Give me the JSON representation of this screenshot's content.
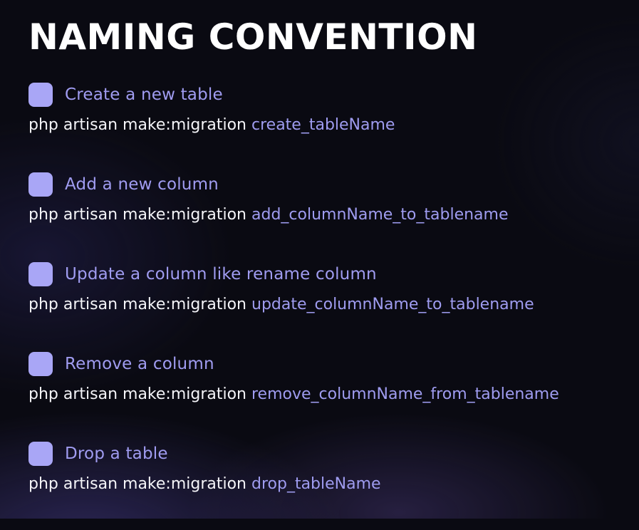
{
  "title": "NAMING CONVENTION",
  "items": [
    {
      "label": "Create a new table",
      "command_prefix": "php artisan make:migration",
      "command_name": "create_tableName"
    },
    {
      "label": "Add a new column",
      "command_prefix": "php artisan make:migration",
      "command_name": "add_columnName_to_tablename"
    },
    {
      "label": "Update a column like rename column",
      "command_prefix": "php artisan make:migration",
      "command_name": "update_columnName_to_tablename"
    },
    {
      "label": "Remove a column",
      "command_prefix": "php artisan make:migration",
      "command_name": "remove_columnName_from_tablename"
    },
    {
      "label": "Drop a table",
      "command_prefix": "php artisan make:migration",
      "command_name": "drop_tableName"
    }
  ],
  "colors": {
    "background": "#0a0a12",
    "accent": "#a09cf1",
    "checkbox": "#a9a6f6",
    "text": "#f4f4f8"
  }
}
